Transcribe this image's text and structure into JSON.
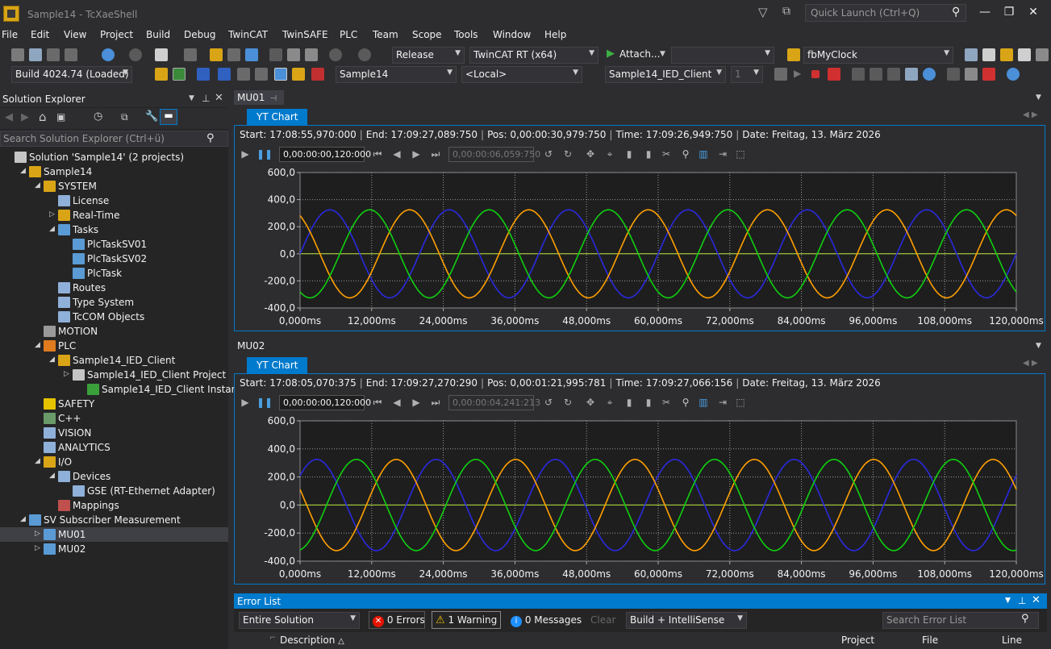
{
  "window": {
    "title": "Sample14 - TcXaeShell",
    "quick_launch_placeholder": "Quick Launch (Ctrl+Q)"
  },
  "menu": [
    "File",
    "Edit",
    "View",
    "Project",
    "Build",
    "Debug",
    "TwinCAT",
    "TwinSAFE",
    "PLC",
    "Team",
    "Scope",
    "Tools",
    "Window",
    "Help"
  ],
  "toolbar1": {
    "config": "Release",
    "platform": "TwinCAT RT (x64)",
    "attach": "Attach...",
    "attach_combo": "",
    "function_block": "fbMyClock"
  },
  "toolbar2": {
    "build": "Build 4024.74 (Loaded)",
    "project": "Sample14",
    "target": "<Local>",
    "plc_project": "Sample14_IED_Client",
    "instance": "1"
  },
  "solution_explorer": {
    "title": "Solution Explorer",
    "search_placeholder": "Search Solution Explorer (Ctrl+ü)",
    "items": [
      {
        "label": "Solution 'Sample14' (2 projects)",
        "level": 0,
        "exp": "",
        "icon": "solution-icon",
        "color": "#c5c5c5"
      },
      {
        "label": "Sample14",
        "level": 1,
        "exp": "◢",
        "icon": "twincat-project-icon",
        "color": "#d9a516"
      },
      {
        "label": "SYSTEM",
        "level": 2,
        "exp": "◢",
        "icon": "system-icon",
        "color": "#d9a516"
      },
      {
        "label": "License",
        "level": 3,
        "exp": "",
        "icon": "license-icon",
        "color": "#8fb0d8"
      },
      {
        "label": "Real-Time",
        "level": 3,
        "exp": "▷",
        "icon": "realtime-icon",
        "color": "#d9a516"
      },
      {
        "label": "Tasks",
        "level": 3,
        "exp": "◢",
        "icon": "tasks-icon",
        "color": "#5a9bd5"
      },
      {
        "label": "PlcTaskSV01",
        "level": 4,
        "exp": "",
        "icon": "task-icon",
        "color": "#5a9bd5"
      },
      {
        "label": "PlcTaskSV02",
        "level": 4,
        "exp": "",
        "icon": "task-icon",
        "color": "#5a9bd5"
      },
      {
        "label": "PlcTask",
        "level": 4,
        "exp": "",
        "icon": "task-icon",
        "color": "#5a9bd5"
      },
      {
        "label": "Routes",
        "level": 3,
        "exp": "",
        "icon": "routes-icon",
        "color": "#8fb0d8"
      },
      {
        "label": "Type System",
        "level": 3,
        "exp": "",
        "icon": "type-system-icon",
        "color": "#8fb0d8"
      },
      {
        "label": "TcCOM Objects",
        "level": 3,
        "exp": "",
        "icon": "tccom-icon",
        "color": "#8fb0d8"
      },
      {
        "label": "MOTION",
        "level": 2,
        "exp": "",
        "icon": "motion-icon",
        "color": "#9a9a9a"
      },
      {
        "label": "PLC",
        "level": 2,
        "exp": "◢",
        "icon": "plc-icon",
        "color": "#e07b1f"
      },
      {
        "label": "Sample14_IED_Client",
        "level": 3,
        "exp": "◢",
        "icon": "plc-project-icon",
        "color": "#d9a516"
      },
      {
        "label": "Sample14_IED_Client Project",
        "level": 4,
        "exp": "▷",
        "icon": "plc-project-file-icon",
        "color": "#c5c5c5"
      },
      {
        "label": "Sample14_IED_Client Instance",
        "level": 5,
        "exp": "",
        "icon": "plc-instance-icon",
        "color": "#3aa03a"
      },
      {
        "label": "SAFETY",
        "level": 2,
        "exp": "",
        "icon": "safety-icon",
        "color": "#e6c200"
      },
      {
        "label": "C++",
        "level": 2,
        "exp": "",
        "icon": "cpp-icon",
        "color": "#6a9a6a"
      },
      {
        "label": "VISION",
        "level": 2,
        "exp": "",
        "icon": "vision-icon",
        "color": "#8fb0d8"
      },
      {
        "label": "ANALYTICS",
        "level": 2,
        "exp": "",
        "icon": "analytics-icon",
        "color": "#8fb0d8"
      },
      {
        "label": "I/O",
        "level": 2,
        "exp": "◢",
        "icon": "io-icon",
        "color": "#d9a516"
      },
      {
        "label": "Devices",
        "level": 3,
        "exp": "◢",
        "icon": "devices-icon",
        "color": "#8fb0d8"
      },
      {
        "label": "GSE (RT-Ethernet Adapter)",
        "level": 4,
        "exp": "",
        "icon": "ethernet-adapter-icon",
        "color": "#8fb0d8"
      },
      {
        "label": "Mappings",
        "level": 3,
        "exp": "",
        "icon": "mappings-icon",
        "color": "#c0504d"
      },
      {
        "label": "SV Subscriber Measurement",
        "level": 1,
        "exp": "◢",
        "icon": "measurement-project-icon",
        "color": "#5a9bd5"
      },
      {
        "label": "MU01",
        "level": 2,
        "exp": "▷",
        "icon": "scope-icon",
        "color": "#5a9bd5",
        "selected": true
      },
      {
        "label": "MU02",
        "level": 2,
        "exp": "▷",
        "icon": "scope-icon",
        "color": "#5a9bd5"
      }
    ]
  },
  "charts": [
    {
      "doc_tab": "MU01",
      "tab": "YT Chart",
      "start_label": "Start:",
      "start": "17:08:55,970:000",
      "end_label": "End:",
      "end": "17:09:27,089:750",
      "pos_label": "Pos:",
      "pos": "0,00:00:30,979:750",
      "time_label": "Time:",
      "time": "17:09:26,949:750",
      "date_label": "Date:",
      "date": "Freitag, 13. März 2026",
      "interval": "0,00:00:00,120:000",
      "offset": "0,00:00:06,059:750"
    },
    {
      "doc_tab": "MU02",
      "tab": "YT Chart",
      "start_label": "Start:",
      "start": "17:08:05,070:375",
      "end_label": "End:",
      "end": "17:09:27,270:290",
      "pos_label": "Pos:",
      "pos": "0,00:01:21,995:781",
      "time_label": "Time:",
      "time": "17:09:27,066:156",
      "date_label": "Date:",
      "date": "Freitag, 13. März 2026",
      "interval": "0,00:00:00,120:000",
      "offset": "0,00:00:04,241:213"
    }
  ],
  "chart_data": [
    {
      "type": "line",
      "x_ticks": [
        "0,000ms",
        "12,000ms",
        "24,000ms",
        "36,000ms",
        "48,000ms",
        "60,000ms",
        "72,000ms",
        "84,000ms",
        "96,000ms",
        "108,000ms",
        "120,000ms"
      ],
      "y_ticks": [
        "600,0",
        "400,0",
        "200,0",
        "0,0",
        "-200,0",
        "-400,0"
      ],
      "xlim": [
        0,
        120
      ],
      "ylim": [
        -400,
        600
      ],
      "grid": true,
      "period_ms": 20,
      "series": [
        {
          "amplitude": 325,
          "phase_deg": 0,
          "color": "#2a2ae0"
        },
        {
          "amplitude": 325,
          "phase_deg": 120,
          "color": "#ffa000"
        },
        {
          "amplitude": 325,
          "phase_deg": -120,
          "color": "#10d010"
        }
      ],
      "zero_line_color": "#b8e03a"
    },
    {
      "type": "line",
      "x_ticks": [
        "0,000ms",
        "12,000ms",
        "24,000ms",
        "36,000ms",
        "48,000ms",
        "60,000ms",
        "72,000ms",
        "84,000ms",
        "96,000ms",
        "108,000ms",
        "120,000ms"
      ],
      "y_ticks": [
        "600,0",
        "400,0",
        "200,0",
        "0,0",
        "-200,0",
        "-400,0"
      ],
      "xlim": [
        0,
        120
      ],
      "ylim": [
        -400,
        600
      ],
      "grid": true,
      "period_ms": 20,
      "series": [
        {
          "amplitude": 325,
          "phase_deg": 40,
          "color": "#2a2ae0"
        },
        {
          "amplitude": 325,
          "phase_deg": 160,
          "color": "#ffa000"
        },
        {
          "amplitude": 325,
          "phase_deg": -80,
          "color": "#10d010"
        }
      ],
      "zero_line_color": "#b8e03a"
    }
  ],
  "error_list": {
    "title": "Error List",
    "scope": "Entire Solution",
    "errors": "0 Errors",
    "warnings": "1 Warning",
    "messages": "0 Messages",
    "clear": "Clear",
    "filter": "Build + IntelliSense",
    "search_placeholder": "Search Error List",
    "columns": {
      "description": "Description",
      "project": "Project",
      "file": "File",
      "line": "Line"
    }
  }
}
